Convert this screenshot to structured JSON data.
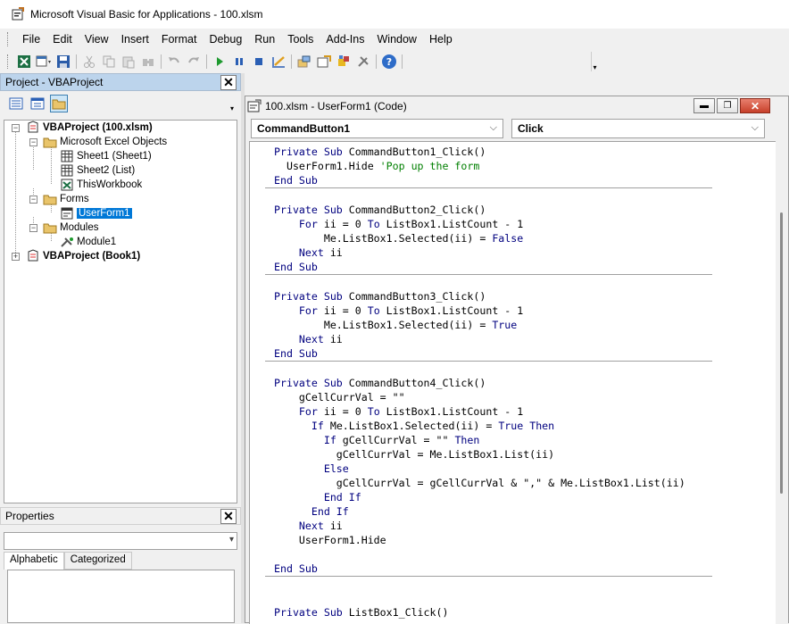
{
  "window": {
    "title": "Microsoft Visual Basic for Applications - 100.xlsm"
  },
  "menu": [
    "File",
    "Edit",
    "View",
    "Insert",
    "Format",
    "Debug",
    "Run",
    "Tools",
    "Add-Ins",
    "Window",
    "Help"
  ],
  "toolbar": {
    "icons": [
      "excel-icon",
      "insert-userform-icon",
      "save-icon",
      "cut-icon",
      "copy-icon",
      "paste-icon",
      "find-icon",
      "undo-icon",
      "redo-icon",
      "run-icon",
      "break-icon",
      "reset-icon",
      "design-mode-icon",
      "project-explorer-icon",
      "properties-window-icon",
      "object-browser-icon",
      "toolbox-icon",
      "help-icon"
    ]
  },
  "project_panel": {
    "title": "Project - VBAProject",
    "close": "✕",
    "tree": [
      {
        "label": "VBAProject (100.xlsm)",
        "bold": true
      },
      {
        "label": "Microsoft Excel Objects"
      },
      {
        "label": "Sheet1 (Sheet1)"
      },
      {
        "label": "Sheet2 (List)"
      },
      {
        "label": "ThisWorkbook"
      },
      {
        "label": "Forms"
      },
      {
        "label": "UserForm1",
        "selected": true
      },
      {
        "label": "Modules"
      },
      {
        "label": "Module1"
      },
      {
        "label": "VBAProject (Book1)",
        "bold": true
      }
    ]
  },
  "properties_panel": {
    "title": "Properties",
    "close": "✕",
    "object_value": "",
    "tabs": [
      "Alphabetic",
      "Categorized"
    ]
  },
  "code_window": {
    "title": "100.xlsm - UserForm1 (Code)",
    "object_combo": "CommandButton1",
    "procedure_combo": "Click",
    "procedures": [
      [
        [
          [
            "kw",
            "Private Sub "
          ],
          [
            "t",
            "CommandButton1_Click()"
          ]
        ],
        [
          [
            "t",
            "  UserForm1.Hide "
          ],
          [
            "cm",
            "'Pop up the form"
          ]
        ],
        [
          [
            "kw",
            "End Sub"
          ]
        ]
      ],
      [
        [
          [
            "t",
            ""
          ]
        ],
        [
          [
            "kw",
            "Private Sub "
          ],
          [
            "t",
            "CommandButton2_Click()"
          ]
        ],
        [
          [
            "t",
            "    "
          ],
          [
            "kw",
            "For "
          ],
          [
            "t",
            "ii = 0 "
          ],
          [
            "kw",
            "To "
          ],
          [
            "t",
            "ListBox1.ListCount - 1"
          ]
        ],
        [
          [
            "t",
            "        Me.ListBox1.Selected(ii) = "
          ],
          [
            "kw",
            "False"
          ]
        ],
        [
          [
            "t",
            "    "
          ],
          [
            "kw",
            "Next "
          ],
          [
            "t",
            "ii"
          ]
        ],
        [
          [
            "kw",
            "End Sub"
          ]
        ]
      ],
      [
        [
          [
            "t",
            ""
          ]
        ],
        [
          [
            "kw",
            "Private Sub "
          ],
          [
            "t",
            "CommandButton3_Click()"
          ]
        ],
        [
          [
            "t",
            "    "
          ],
          [
            "kw",
            "For "
          ],
          [
            "t",
            "ii = 0 "
          ],
          [
            "kw",
            "To "
          ],
          [
            "t",
            "ListBox1.ListCount - 1"
          ]
        ],
        [
          [
            "t",
            "        Me.ListBox1.Selected(ii) = "
          ],
          [
            "kw",
            "True"
          ]
        ],
        [
          [
            "t",
            "    "
          ],
          [
            "kw",
            "Next "
          ],
          [
            "t",
            "ii"
          ]
        ],
        [
          [
            "kw",
            "End Sub"
          ]
        ]
      ],
      [
        [
          [
            "t",
            ""
          ]
        ],
        [
          [
            "kw",
            "Private Sub "
          ],
          [
            "t",
            "CommandButton4_Click()"
          ]
        ],
        [
          [
            "t",
            "    gCellCurrVal = \"\""
          ]
        ],
        [
          [
            "t",
            "    "
          ],
          [
            "kw",
            "For "
          ],
          [
            "t",
            "ii = 0 "
          ],
          [
            "kw",
            "To "
          ],
          [
            "t",
            "ListBox1.ListCount - 1"
          ]
        ],
        [
          [
            "t",
            "      "
          ],
          [
            "kw",
            "If "
          ],
          [
            "t",
            "Me.ListBox1.Selected(ii) = "
          ],
          [
            "kw",
            "True Then"
          ]
        ],
        [
          [
            "t",
            "        "
          ],
          [
            "kw",
            "If "
          ],
          [
            "t",
            "gCellCurrVal = \"\" "
          ],
          [
            "kw",
            "Then"
          ]
        ],
        [
          [
            "t",
            "          gCellCurrVal = Me.ListBox1.List(ii)"
          ]
        ],
        [
          [
            "t",
            "        "
          ],
          [
            "kw",
            "Else"
          ]
        ],
        [
          [
            "t",
            "          gCellCurrVal = gCellCurrVal & \",\" & Me.ListBox1.List(ii)"
          ]
        ],
        [
          [
            "t",
            "        "
          ],
          [
            "kw",
            "End If"
          ]
        ],
        [
          [
            "t",
            "      "
          ],
          [
            "kw",
            "End If"
          ]
        ],
        [
          [
            "t",
            "    "
          ],
          [
            "kw",
            "Next "
          ],
          [
            "t",
            "ii"
          ]
        ],
        [
          [
            "t",
            "    UserForm1.Hide"
          ]
        ],
        [
          [
            "t",
            ""
          ]
        ],
        [
          [
            "kw",
            "End Sub"
          ]
        ]
      ],
      [
        [
          [
            "t",
            ""
          ]
        ],
        [
          [
            "t",
            ""
          ]
        ],
        [
          [
            "kw",
            "Private Sub "
          ],
          [
            "t",
            "ListBox1_Click()"
          ]
        ]
      ]
    ]
  },
  "colors": {
    "keyword": "#00007f",
    "comment": "#007f00",
    "selection": "#0078d7",
    "panel_header": "#bcd4ec"
  }
}
